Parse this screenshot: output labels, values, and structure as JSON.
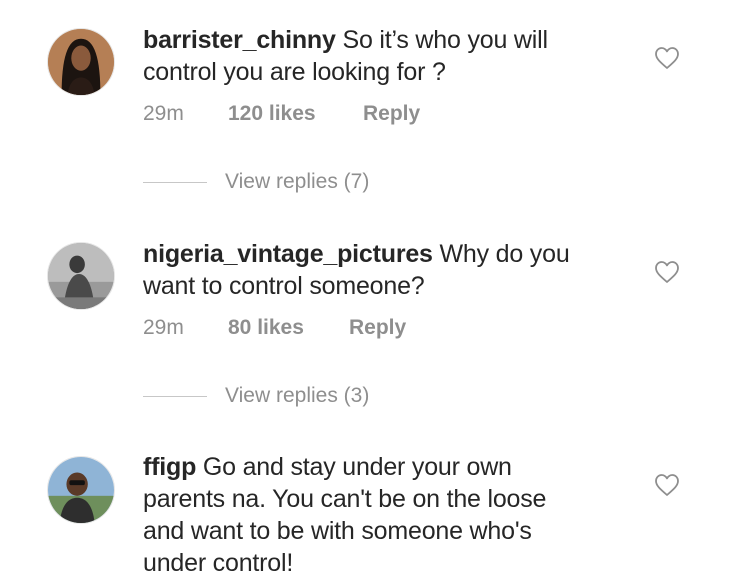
{
  "colors": {
    "text": "#262626",
    "secondary": "#8e8e8e",
    "divider": "#c7c7c7",
    "background": "#ffffff"
  },
  "comments": [
    {
      "username": "barrister_chinny",
      "text_line1": " So it’s who you will",
      "text_line2": "control you are looking for ?",
      "time": "29m",
      "likes": "120 likes",
      "reply": "Reply",
      "view_replies": "View replies (7)",
      "avatar_icon": "profile-photo",
      "like_icon": "heart-outline-icon"
    },
    {
      "username": "nigeria_vintage_pictures",
      "text_line1": " Why do you",
      "text_line2": "want to control someone?",
      "time": "29m",
      "likes": "80 likes",
      "reply": "Reply",
      "view_replies": "View replies (3)",
      "avatar_icon": "profile-photo",
      "like_icon": "heart-outline-icon"
    },
    {
      "username": "ffigp",
      "text_line1": " Go and stay under your own",
      "text_line2": "parents na. You can't be on the loose",
      "text_line3": "and want to be with someone who's",
      "text_line4": "under control!",
      "avatar_icon": "profile-photo",
      "like_icon": "heart-outline-icon"
    }
  ]
}
